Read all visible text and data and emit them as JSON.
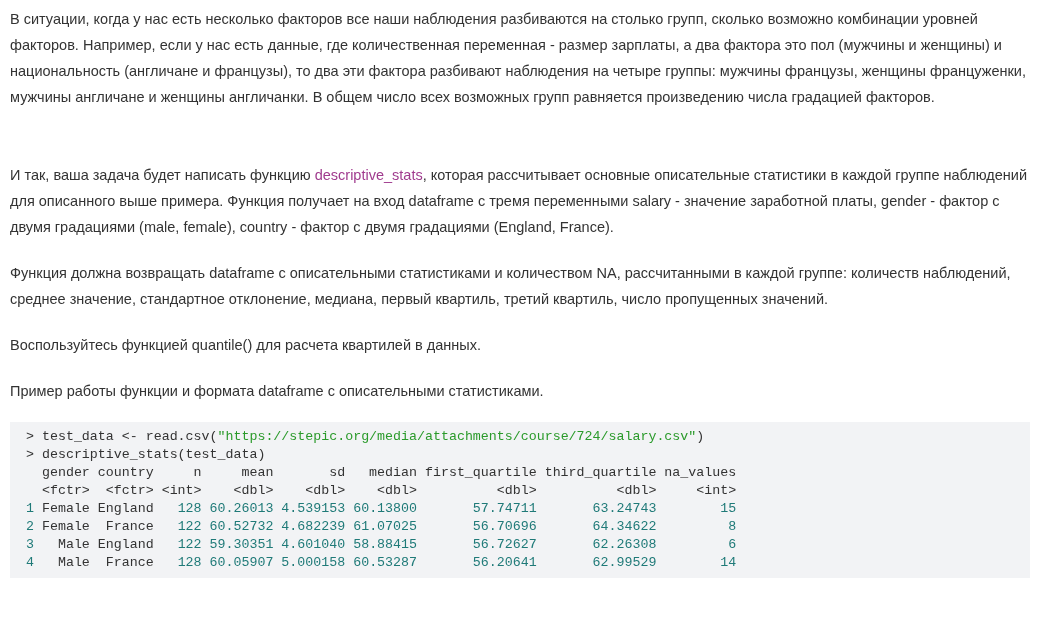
{
  "paragraphs": [
    {
      "segments": [
        {
          "kind": "text",
          "text": "В ситуации, когда у нас есть несколько факторов все наши наблюдения разбиваются на столько групп, сколько возможно комбинации уровней факторов. Например, если у нас есть данные, где количественная переменная - размер зарплаты, а два фактора это пол (мужчины и женщины) и национальность (англичане и французы), то два эти фактора разбивают наблюдения на четыре группы:  мужчины французы, женщины француженки, мужчины англичане и женщины англичанки.  В общем число всех возможных групп равняется произведению числа градацией факторов."
        }
      ]
    },
    {
      "segments": [
        {
          "kind": "text",
          "text": "И так, ваша задача будет написать функцию "
        },
        {
          "kind": "link",
          "text": "descriptive_stats"
        },
        {
          "kind": "text",
          "text": ", которая рассчитывает основные описательные статистики в каждой группе наблюдений для описанного выше примера. Функция получает на вход dataframe с тремя переменными salary - значение заработной платы, gender - фактор с двумя градациями (male, female), country - фактор с двумя градациями (England, France)."
        }
      ]
    },
    {
      "segments": [
        {
          "kind": "text",
          "text": "Функция должна возвращать dataframe с описательными статистиками и количеством NA, рассчитанными в каждой группе: количеств наблюдений, среднее значение, стандартное отклонение, медиана, первый квартиль, третий квартиль, число пропущенных значений."
        }
      ]
    },
    {
      "segments": [
        {
          "kind": "text",
          "text": "Воспользуйтесь функцией quantile() для расчета квартилей в данных."
        }
      ]
    },
    {
      "segments": [
        {
          "kind": "text",
          "text": "Пример работы функции и формата dataframe с описательными статистиками."
        }
      ]
    }
  ],
  "code_lines": [
    [
      {
        "kind": "plain",
        "text": "> test_data <- read.csv("
      },
      {
        "kind": "string",
        "text": "\"https://stepic.org/media/attachments/course/724/salary.csv\""
      },
      {
        "kind": "plain",
        "text": ")"
      }
    ],
    [
      {
        "kind": "plain",
        "text": "> descriptive_stats(test_data)"
      }
    ],
    [
      {
        "kind": "plain",
        "text": "  gender country     n     mean       sd   median first_quartile third_quartile na_values"
      }
    ],
    [
      {
        "kind": "plain",
        "text": "  <fctr>  <fctr> <int>    <dbl>    <dbl>    <dbl>          <dbl>          <dbl>     <int>"
      }
    ],
    [
      {
        "kind": "number",
        "text": "1"
      },
      {
        "kind": "plain",
        "text": " Female England"
      },
      {
        "kind": "number",
        "text": "   128 60.26013 4.539153 60.13800       57.74711       63.24743        15"
      }
    ],
    [
      {
        "kind": "number",
        "text": "2"
      },
      {
        "kind": "plain",
        "text": " Female  France"
      },
      {
        "kind": "number",
        "text": "   122 60.52732 4.682239 61.07025       56.70696       64.34622         8"
      }
    ],
    [
      {
        "kind": "number",
        "text": "3"
      },
      {
        "kind": "plain",
        "text": "   Male England"
      },
      {
        "kind": "number",
        "text": "   122 59.30351 4.601040 58.88415       56.72627       62.26308         6"
      }
    ],
    [
      {
        "kind": "number",
        "text": "4"
      },
      {
        "kind": "plain",
        "text": "   Male  France"
      },
      {
        "kind": "number",
        "text": "   128 60.05907 5.000158 60.53287       56.20641       62.99529        14"
      }
    ]
  ]
}
